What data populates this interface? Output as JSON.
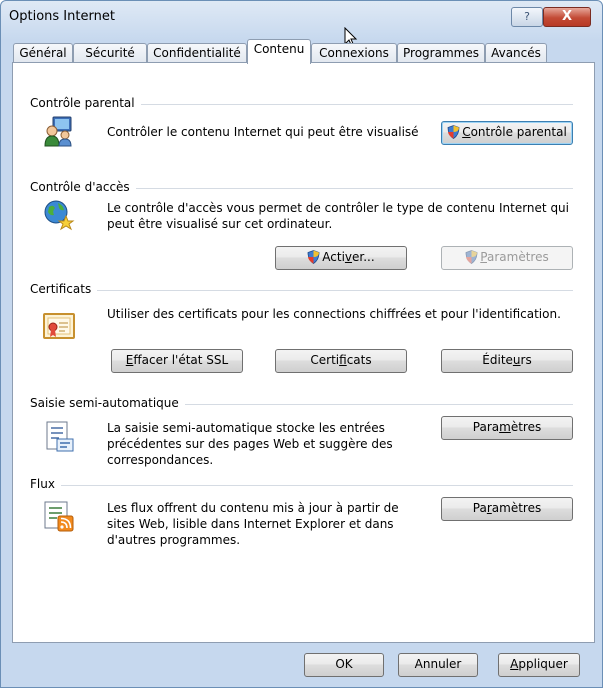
{
  "window": {
    "title": "Options Internet",
    "help_label": "?",
    "close_label": "X"
  },
  "tabs": [
    {
      "label": "Général"
    },
    {
      "label": "Sécurité"
    },
    {
      "label": "Confidentialité"
    },
    {
      "label": "Contenu",
      "active": true
    },
    {
      "label": "Connexions"
    },
    {
      "label": "Programmes"
    },
    {
      "label": "Avancés"
    }
  ],
  "parental": {
    "title": "Contrôle parental",
    "description": "Contrôler le contenu Internet qui peut être visualisé",
    "button_pre": "",
    "button_u": "C",
    "button_post": "ontrôle parental"
  },
  "access": {
    "title": "Contrôle d'accès",
    "description": "Le contrôle d'accès vous permet de contrôler le type de contenu Internet qui peut être visualisé sur cet ordinateur.",
    "activate_pre": "Acti",
    "activate_u": "v",
    "activate_post": "er...",
    "settings_pre": "",
    "settings_u": "P",
    "settings_post": "aramètres"
  },
  "certificates": {
    "title": "Certificats",
    "description": "Utiliser des certificats pour les connections chiffrées et pour l'identification.",
    "clear_pre": "",
    "clear_u": "E",
    "clear_post": "ffacer l'état SSL",
    "certs_pre": "Certi",
    "certs_u": "f",
    "certs_post": "icats",
    "publishers_pre": "Édite",
    "publishers_u": "u",
    "publishers_post": "rs"
  },
  "autocomplete": {
    "title": "Saisie semi-automatique",
    "description": "La saisie semi-automatique stocke les entrées précédentes sur des pages Web et suggère des correspondances.",
    "settings_pre": "Para",
    "settings_u": "m",
    "settings_post": "ètres"
  },
  "feeds": {
    "title": "Flux",
    "description": "Les flux offrent du contenu mis à jour à partir de sites Web, lisible dans Internet Explorer et dans d'autres programmes.",
    "settings_pre": "Pa",
    "settings_u": "r",
    "settings_post": "amètres"
  },
  "footer": {
    "ok": "OK",
    "cancel": "Annuler",
    "apply_pre": "",
    "apply_u": "A",
    "apply_post": "ppliquer"
  }
}
